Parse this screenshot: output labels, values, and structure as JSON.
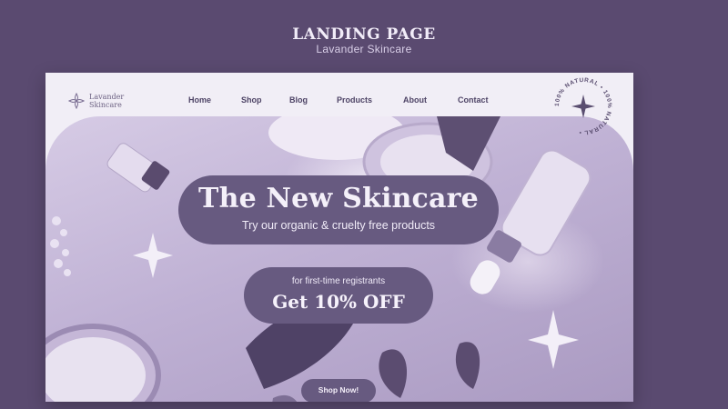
{
  "page": {
    "title": "LANDING PAGE",
    "subtitle": "Lavander Skincare"
  },
  "brand": {
    "line1": "Lavander",
    "line2": "Skincare"
  },
  "nav": {
    "items": [
      "Home",
      "Shop",
      "Blog",
      "Products",
      "About",
      "Contact"
    ]
  },
  "badge": {
    "text": "100% NATURAL • 100% NATURAL • "
  },
  "hero": {
    "headline": "The New Skincare",
    "subheadline": "Try our organic & cruelty free products"
  },
  "offer": {
    "small": "for first-time registrants",
    "big": "Get 10% OFF"
  },
  "cta": {
    "label": "Shop Now!"
  },
  "colors": {
    "background": "#5a4a70",
    "card": "#f1eef6",
    "pill": "#675a80",
    "text_light": "#f4f0f9",
    "nav_text": "#4e4466"
  },
  "icons": [
    "lotus-logo-icon",
    "sparkle-icon",
    "star-icon"
  ]
}
